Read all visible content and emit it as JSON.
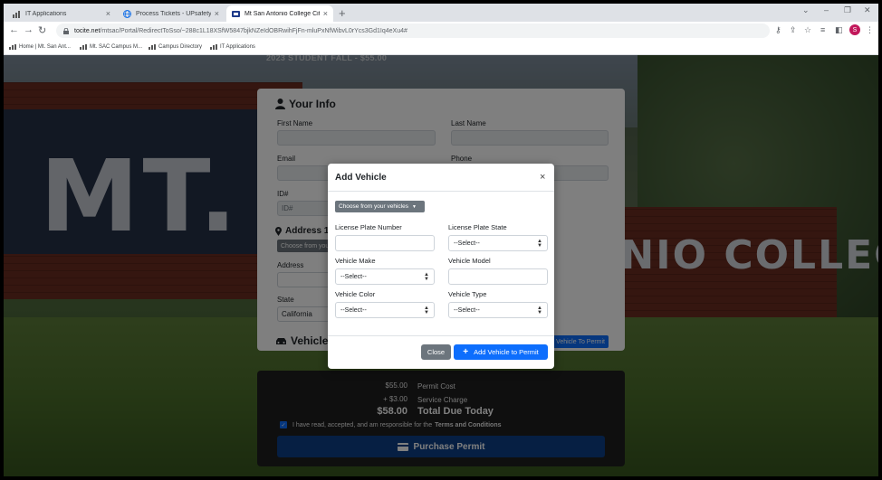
{
  "browser": {
    "tabs": [
      {
        "label": "IT Applications",
        "icon": "chart-icon",
        "active": false
      },
      {
        "label": "Process Tickets - UPsafety Cloud",
        "icon": "globe-icon",
        "active": false
      },
      {
        "label": "Mt San Antonio College Citizen",
        "icon": "portal-icon",
        "active": true
      }
    ],
    "new_tab": "+",
    "url_host": "tocite.net",
    "url_path": "/mtsac/Portal/RedirectToSso/~288c1L18XSfW5847bjkNZeIdOBRwihFjFn-mluPxNfWibvL0rYcs3Gd1Iq4eXu4#",
    "profile_initial": "S",
    "bookmarks": [
      "Home | Mt. San Ant...",
      "Mt. SAC Campus M...",
      "Campus Directory",
      "IT Applications"
    ]
  },
  "page": {
    "plan_title": "2023 STUDENT FALL - $55.00",
    "bg_sign_left": "MT.",
    "bg_sign_right": "TONIO COLLEGE",
    "your_info": {
      "heading": "Your Info",
      "first_name": "First Name",
      "last_name": "Last Name",
      "email": "Email",
      "phone": "Phone",
      "id": "ID#",
      "id_placeholder": "ID#"
    },
    "address": {
      "heading": "Address 1",
      "choose": "Choose from your",
      "address_label": "Address",
      "state_label": "State",
      "state_value": "California"
    },
    "vehicles": {
      "heading": "Vehicles",
      "add_button": "Vehicle To Permit"
    },
    "summary": {
      "permit_cost_amount": "$55.00",
      "permit_cost_label": "Permit Cost",
      "service_amount": "+ $3.00",
      "service_label": "Service Charge",
      "total_amount": "$58.00",
      "total_label": "Total Due Today",
      "terms_text": "I have read, accepted, and am responsible for the",
      "terms_link": "Terms and Conditions",
      "purchase": "Purchase Permit"
    }
  },
  "modal": {
    "title": "Add Vehicle",
    "close_x": "×",
    "choose": "Choose from your vehicles",
    "plate_number": "License Plate Number",
    "plate_state": "License Plate State",
    "plate_state_value": "--Select--",
    "make": "Vehicle Make",
    "make_value": "--Select--",
    "model": "Vehicle Model",
    "color": "Vehicle Color",
    "color_value": "--Select--",
    "type": "Vehicle Type",
    "type_value": "--Select--",
    "close_button": "Close",
    "add_button": "Add Vehicle to Permit"
  },
  "colors": {
    "primary": "#0d6efd",
    "secondary": "#6c757d"
  }
}
